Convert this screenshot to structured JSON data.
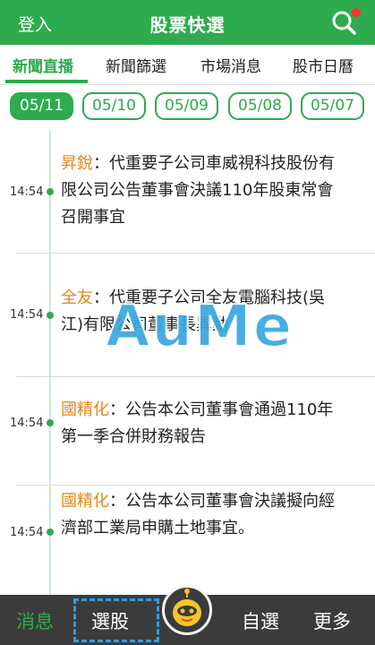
{
  "header": {
    "login_label": "登入",
    "title": "股票快選",
    "search_icon": "search-icon",
    "notification_color": "#ff2f2f"
  },
  "tabs": [
    {
      "label": "新聞直播",
      "active": true
    },
    {
      "label": "新聞篩選",
      "active": false
    },
    {
      "label": "市場消息",
      "active": false
    },
    {
      "label": "股市日曆",
      "active": false
    }
  ],
  "dates": [
    {
      "label": "05/11",
      "active": true
    },
    {
      "label": "05/10",
      "active": false
    },
    {
      "label": "05/09",
      "active": false
    },
    {
      "label": "05/08",
      "active": false
    },
    {
      "label": "05/07",
      "active": false
    }
  ],
  "news": [
    {
      "time": "14:54",
      "stock": "昇銳",
      "separator": "：",
      "text": "代重要子公司車威視科技股份有限公司公告董事會決議110年股東常會召開事宜"
    },
    {
      "time": "14:54",
      "stock": "全友",
      "separator": "：",
      "text": "代重要子公司全友電腦科技(吳江)有限公司董事長異動"
    },
    {
      "time": "14:54",
      "stock": "國精化",
      "separator": "：",
      "text": "公告本公司董事會通過110年第一季合併財務報告"
    },
    {
      "time": "14:54",
      "stock": "國精化",
      "separator": "：",
      "text": "公告本公司董事會決議擬向經濟部工業局申購土地事宜。"
    }
  ],
  "watermark": "AuMe",
  "bottom_nav": {
    "news_label": "消息",
    "screener_label": "選股",
    "watchlist_label": "自選",
    "more_label": "更多",
    "mascot_icon": "mascot-icon"
  },
  "colors": {
    "brand_green": "#2eab4e",
    "stock_orange": "#e2861e",
    "nav_bg": "#3b3b3b",
    "highlight_blue": "#2a9ee6"
  }
}
